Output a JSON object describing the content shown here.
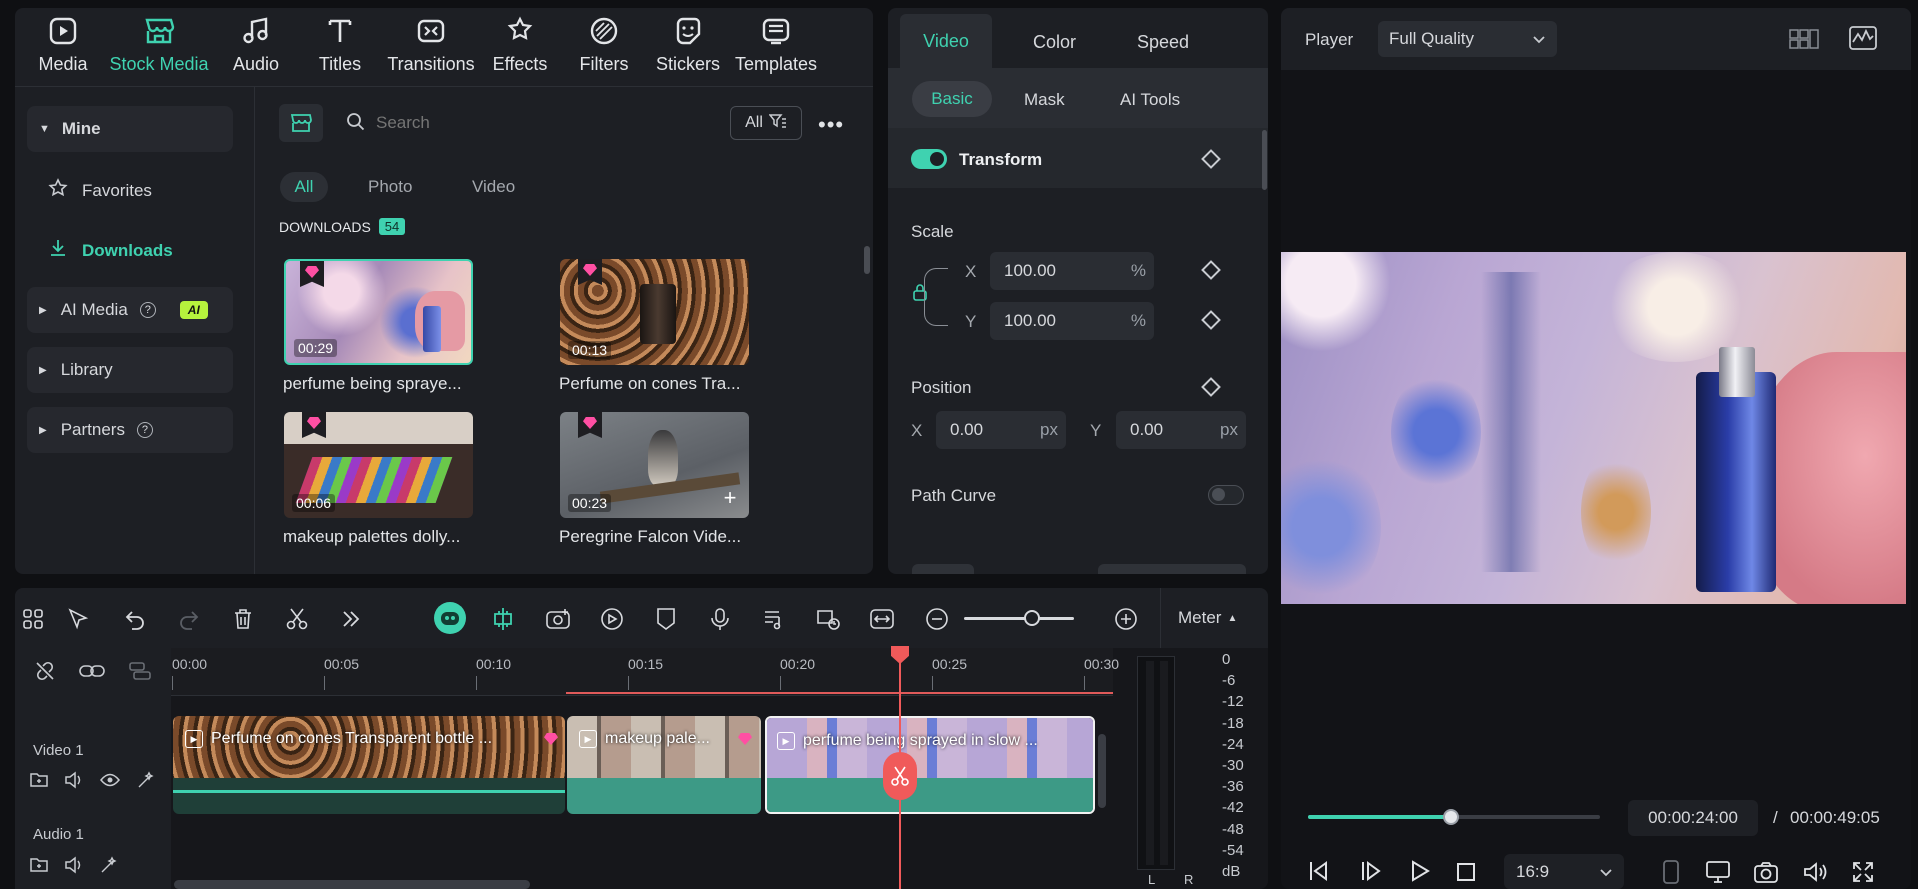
{
  "nav": {
    "items": [
      {
        "label": "Media",
        "icon": "media-icon"
      },
      {
        "label": "Stock Media",
        "icon": "stock-media-icon",
        "active": true
      },
      {
        "label": "Audio",
        "icon": "audio-icon"
      },
      {
        "label": "Titles",
        "icon": "titles-icon"
      },
      {
        "label": "Transitions",
        "icon": "transitions-icon"
      },
      {
        "label": "Effects",
        "icon": "effects-icon"
      },
      {
        "label": "Filters",
        "icon": "filters-icon"
      },
      {
        "label": "Stickers",
        "icon": "stickers-icon"
      },
      {
        "label": "Templates",
        "icon": "templates-icon"
      }
    ]
  },
  "sidebar": {
    "mine": "Mine",
    "favorites": "Favorites",
    "downloads": "Downloads",
    "ai_media": "AI Media",
    "ai_badge": "AI",
    "library": "Library",
    "partners": "Partners"
  },
  "browser": {
    "search_placeholder": "Search",
    "filter_all": "All",
    "tabs": [
      "All",
      "Photo",
      "Video"
    ],
    "section": "DOWNLOADS",
    "count": "54",
    "items": [
      {
        "duration": "00:29",
        "caption": "perfume being spraye..."
      },
      {
        "duration": "00:13",
        "caption": "Perfume on cones Tra..."
      },
      {
        "duration": "00:06",
        "caption": "makeup palettes dolly..."
      },
      {
        "duration": "00:23",
        "caption": "Peregrine Falcon Vide..."
      }
    ]
  },
  "props": {
    "tabs": [
      "Video",
      "Color",
      "Speed"
    ],
    "subtabs": [
      "Basic",
      "Mask",
      "AI Tools"
    ],
    "transform": "Transform",
    "scale": "Scale",
    "scale_x_label": "X",
    "scale_x": "100.00",
    "scale_y_label": "Y",
    "scale_y": "100.00",
    "percent": "%",
    "position": "Position",
    "pos_x_label": "X",
    "pos_x": "0.00",
    "pos_y_label": "Y",
    "pos_y": "0.00",
    "px": "px",
    "path_curve": "Path Curve"
  },
  "player": {
    "label": "Player",
    "quality": "Full Quality",
    "current_time": "00:00:24:00",
    "separator": "/",
    "total_time": "00:00:49:05",
    "aspect": "16:9",
    "progress": 0.49
  },
  "timeline": {
    "meter": "Meter",
    "ticks": [
      "00:00",
      "00:05",
      "00:10",
      "00:15",
      "00:20",
      "00:25",
      "00:30"
    ],
    "video_track": "Video 1",
    "audio_track": "Audio 1",
    "clips": [
      {
        "title": "Perfume on cones Transparent bottle ..."
      },
      {
        "title": "makeup pale..."
      },
      {
        "title": "perfume being sprayed in slow ..."
      }
    ],
    "meter_scale": [
      "0",
      "-6",
      "-12",
      "-18",
      "-24",
      "-30",
      "-36",
      "-42",
      "-48",
      "-54",
      "dB"
    ],
    "meter_l": "L",
    "meter_r": "R"
  }
}
